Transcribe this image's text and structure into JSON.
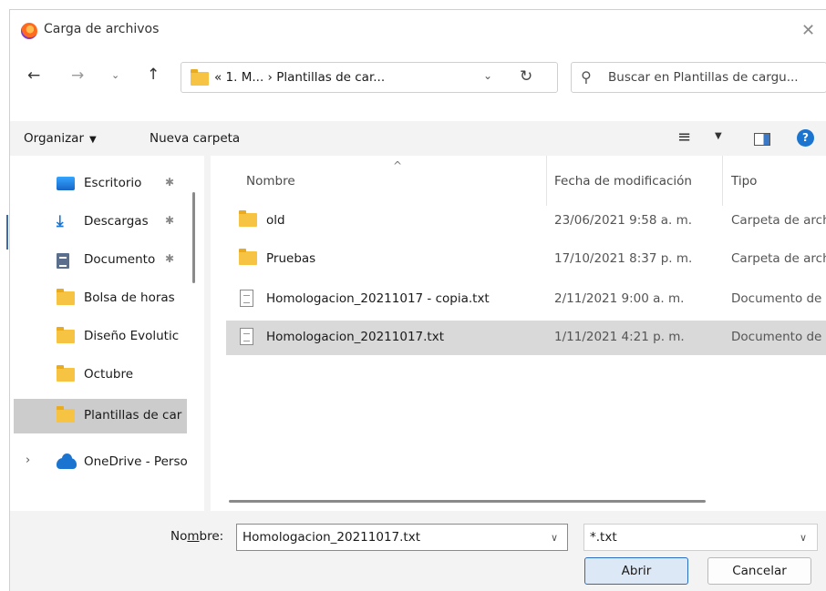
{
  "window": {
    "title": "Carga de archivos",
    "close_symbol": "✕"
  },
  "nav": {
    "back_icon": "arrow-left-icon",
    "forward_icon": "arrow-right-icon",
    "up_icon": "arrow-up-icon",
    "address": "« 1. M...  ›  Plantillas de car...",
    "search_placeholder": "Buscar en Plantillas de cargu..."
  },
  "toolbar": {
    "organize_label": "Organizar",
    "new_folder_label": "Nueva carpeta",
    "help_symbol": "?"
  },
  "sidebar": {
    "items": [
      {
        "label": "Escritorio",
        "icon": "desktop-icon",
        "pinned": true
      },
      {
        "label": "Descargas",
        "icon": "download-icon",
        "pinned": true
      },
      {
        "label": "Documento",
        "icon": "document-icon",
        "pinned": true
      },
      {
        "label": "Bolsa de horas",
        "icon": "folder-icon"
      },
      {
        "label": "Diseño Evolutic",
        "icon": "folder-icon"
      },
      {
        "label": "Octubre",
        "icon": "folder-icon"
      },
      {
        "label": "Plantillas de car",
        "icon": "folder-icon",
        "selected": true
      },
      {
        "label": "OneDrive - Perso",
        "icon": "onedrive-icon"
      }
    ],
    "pin_symbol": "✱",
    "expand_symbol": "›"
  },
  "columns": {
    "name": "Nombre",
    "date": "Fecha de modificación",
    "type": "Tipo"
  },
  "files": [
    {
      "name": "old",
      "date": "23/06/2021 9:58 a. m.",
      "type": "Carpeta de arch",
      "icon": "folder-icon"
    },
    {
      "name": "Pruebas",
      "date": "17/10/2021 8:37 p. m.",
      "type": "Carpeta de arch",
      "icon": "folder-icon"
    },
    {
      "name": "Homologacion_20211017 - copia.txt",
      "date": "2/11/2021 9:00 a. m.",
      "type": "Documento de",
      "icon": "text-file-icon"
    },
    {
      "name": "Homologacion_20211017.txt",
      "date": "1/11/2021 4:21 p. m.",
      "type": "Documento de",
      "icon": "text-file-icon",
      "selected": true
    }
  ],
  "footer": {
    "filename_label_pre": "No",
    "filename_label_ul": "m",
    "filename_label_post": "bre:",
    "filename_value": "Homologacion_20211017.txt",
    "filetype_value": "*.txt",
    "open_label": "Abrir",
    "cancel_label": "Cancelar"
  },
  "colors": {
    "accent": "#1b75d0",
    "selected_row": "#d9d9d9",
    "folder": "#f6c342",
    "open_button_border": "#2a6cc0"
  }
}
